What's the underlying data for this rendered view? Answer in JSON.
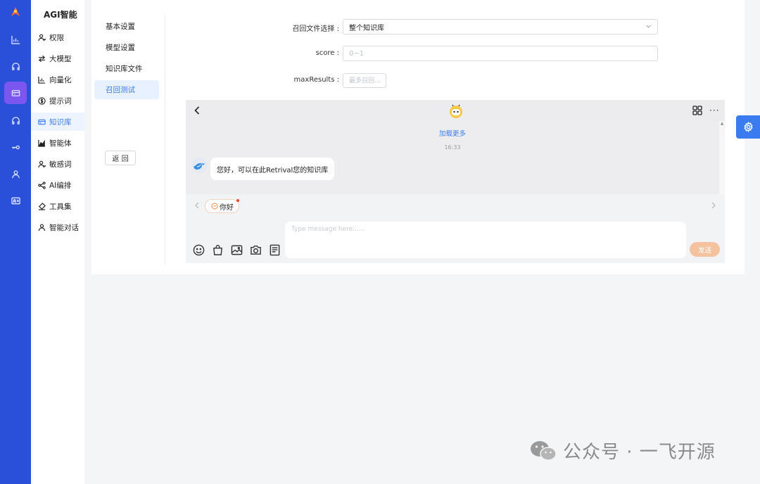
{
  "app": {
    "brand": "AGI智能"
  },
  "rail": {
    "icons": [
      "logo-icon",
      "chart-icon",
      "headset-icon",
      "knowledge-icon",
      "headset-icon",
      "key-icon",
      "user-icon",
      "id-card-icon"
    ]
  },
  "menu": {
    "items": [
      {
        "label": "权限",
        "icon": "user-icon"
      },
      {
        "label": "大模型",
        "icon": "swap-icon"
      },
      {
        "label": "向量化",
        "icon": "chart-icon"
      },
      {
        "label": "提示词",
        "icon": "dollar-icon"
      },
      {
        "label": "知识库",
        "icon": "knowledge-icon",
        "active": true
      },
      {
        "label": "智能体",
        "icon": "area-chart-icon"
      },
      {
        "label": "敏感词",
        "icon": "user-icon"
      },
      {
        "label": "AI编排",
        "icon": "share-icon"
      },
      {
        "label": "工具集",
        "icon": "brush-icon"
      },
      {
        "label": "智能对话",
        "icon": "user-icon"
      }
    ]
  },
  "subnav": {
    "items": [
      "基本设置",
      "模型设置",
      "知识库文件",
      "召回测试"
    ],
    "active_index": 3,
    "back_label": "返 回"
  },
  "form": {
    "recall_label": "召回文件选择 :",
    "recall_value": "整个知识库",
    "score_label": "score :",
    "score_placeholder": "0~1",
    "max_label": "maxResults :",
    "max_placeholder": "最多召回..."
  },
  "chat": {
    "load_more": "加载更多",
    "timestamp": "16:33",
    "bot_message": "您好，可以在此Retrival您的知识库",
    "quick_reply": "你好",
    "input_placeholder": "Type message here......",
    "send_label": "发送",
    "accent": "#f4c29f"
  },
  "watermark": {
    "text": "公众号 · 一飞开源"
  },
  "colors": {
    "rail": "#2a4fd8",
    "rail_active": "#7b57f0",
    "primary": "#3a7bf0"
  }
}
